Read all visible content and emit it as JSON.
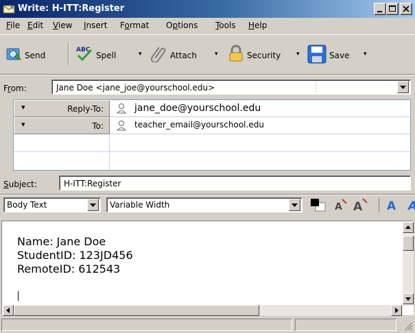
{
  "window": {
    "title": "Write: H-ITT:Register"
  },
  "menu": {
    "items": [
      {
        "label": "File",
        "accel": "F",
        "rest": "ile"
      },
      {
        "label": "Edit",
        "accel": "E",
        "rest": "dit"
      },
      {
        "label": "View",
        "accel": "V",
        "rest": "iew"
      },
      {
        "label": "Insert",
        "accel": "I",
        "rest": "nsert"
      },
      {
        "label": "Format",
        "pre": "F",
        "accel": "o",
        "rest": "rmat"
      },
      {
        "label": "Options",
        "pre": "O",
        "accel": "p",
        "rest": "tions"
      },
      {
        "label": "Tools",
        "accel": "T",
        "rest": "ools"
      },
      {
        "label": "Help",
        "accel": "H",
        "rest": "elp"
      }
    ]
  },
  "toolbar": {
    "send": "Send",
    "spell": "Spell",
    "attach": "Attach",
    "security": "Security",
    "save": "Save",
    "dropdown_glyph": "▾"
  },
  "from": {
    "label_accel": "r",
    "label_pre": "F",
    "label_rest": "om:",
    "value": "Jane Doe <jane_joe@yourschool.edu>"
  },
  "recipients": [
    {
      "type": "Reply-To:",
      "address": "jane_doe@yourschool.edu"
    },
    {
      "type": "To:",
      "address": "teacher_email@yourschool.edu"
    }
  ],
  "subject": {
    "label_accel": "S",
    "label_rest": "ubject:",
    "value": "H-ITT:Register"
  },
  "format_bar": {
    "paragraph_style": "Body Text",
    "font": "Variable Width",
    "text_color": "#000000",
    "background_color": "#ffffff"
  },
  "message_body": {
    "lines": [
      "Name: Jane Doe",
      "StudentID: 123JD456",
      "RemoteID: 612543"
    ]
  },
  "colors": {
    "titlebar_start": "#0a246a",
    "titlebar_end": "#a6caf0",
    "chrome": "#d4d0c8"
  }
}
